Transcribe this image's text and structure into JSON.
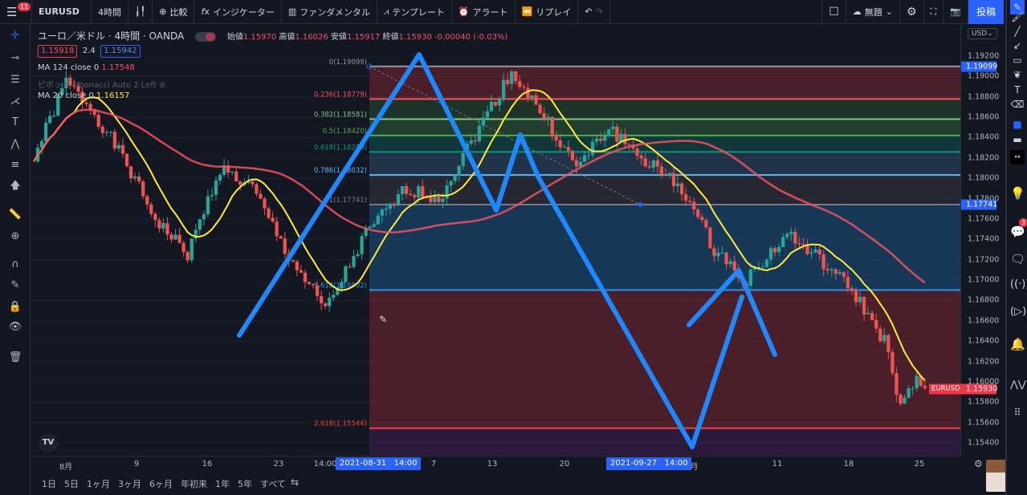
{
  "topbar": {
    "menu_badge": "11",
    "symbol": "EURUSD",
    "interval": "4時間",
    "compare": "比較",
    "indicators": "インジケーター",
    "fundamentals": "ファンダメンタル",
    "templates": "テンプレート",
    "alert": "アラート",
    "replay": "リプレイ",
    "layout_name": "無題",
    "post": "投稿"
  },
  "legend": {
    "title": "ユーロ／米ドル · 4時間 · OANDA",
    "open_label": "始値",
    "open": "1.15970",
    "high_label": "高値",
    "high": "1.16026",
    "low_label": "安値",
    "low": "1.15917",
    "close_label": "終値",
    "close": "1.15930",
    "change": "-0.00040 (-0.03%)",
    "bid": "1.15918",
    "spread": "2.4",
    "ask": "1.15942",
    "ma124": "MA 124 close 0",
    "ma124_val": "1.17548",
    "pivot": "ピボット Fibonacci Auto 2 Left",
    "ma20": "MA 20 close 0",
    "ma20_val": "1.16157"
  },
  "fib": [
    {
      "label": "0(1.19099)",
      "price": 1.19099,
      "color": "#9598a1"
    },
    {
      "label": "0.236(1.18779)",
      "price": 1.18779,
      "color": "#f7525f"
    },
    {
      "label": "0.382(1.18581)",
      "price": 1.18581,
      "color": "#81c784"
    },
    {
      "label": "0.5(1.18420)",
      "price": 1.1842,
      "color": "#4caf50"
    },
    {
      "label": "0.618(1.18259)",
      "price": 1.18259,
      "color": "#089981"
    },
    {
      "label": "0.786(1.18032)",
      "price": 1.18032,
      "color": "#64b5f6"
    },
    {
      "label": "1(1.17741)",
      "price": 1.17741,
      "color": "#787b86"
    },
    {
      "label": "1.618(1.16902)",
      "price": 1.16902,
      "color": "#2196f3"
    },
    {
      "label": "2.618(1.15544)",
      "price": 1.15544,
      "color": "#f44336"
    }
  ],
  "price_axis": {
    "currency": "USD",
    "ticks": [
      "1.19200",
      "1.19000",
      "1.18800",
      "1.18600",
      "1.18400",
      "1.18200",
      "1.18000",
      "1.17800",
      "1.17600",
      "1.17400",
      "1.17200",
      "1.17000",
      "1.16800",
      "1.16600",
      "1.16400",
      "1.16200",
      "1.16000",
      "1.15800",
      "1.15600",
      "1.15400"
    ],
    "tag_top": "1.19099",
    "tag_mid": "1.17741",
    "tag_symbol": "EURUSD",
    "tag_last": "1.15930"
  },
  "time_axis": {
    "labels": [
      "8月",
      "9",
      "16",
      "23",
      "14:00",
      "7",
      "13",
      "20",
      "10月",
      "11",
      "18",
      "25"
    ],
    "hl1": "2021-08-31   14:00",
    "hl2": "2021-09-27   14:00"
  },
  "ranges": [
    "1日",
    "5日",
    "1ヶ月",
    "3ヶ月",
    "6ヶ月",
    "年初来",
    "1年",
    "5年",
    "すべて"
  ],
  "right_badge": "3",
  "price_path": [
    [
      0,
      1.182
    ],
    [
      8,
      1.1895
    ],
    [
      14,
      1.187
    ],
    [
      22,
      1.182
    ],
    [
      30,
      1.176
    ],
    [
      38,
      1.1725
    ],
    [
      46,
      1.181
    ],
    [
      54,
      1.179
    ],
    [
      62,
      1.173
    ],
    [
      72,
      1.167
    ],
    [
      82,
      1.1745
    ],
    [
      92,
      1.179
    ],
    [
      100,
      1.178
    ],
    [
      110,
      1.185
    ],
    [
      118,
      1.1905
    ],
    [
      126,
      1.186
    ],
    [
      134,
      1.181
    ],
    [
      142,
      1.185
    ],
    [
      150,
      1.182
    ],
    [
      160,
      1.179
    ],
    [
      168,
      1.173
    ],
    [
      176,
      1.17
    ],
    [
      186,
      1.1745
    ],
    [
      194,
      1.172
    ],
    [
      202,
      1.169
    ],
    [
      210,
      1.164
    ],
    [
      214,
      1.1575
    ],
    [
      218,
      1.16
    ],
    [
      220,
      1.1593
    ]
  ]
}
